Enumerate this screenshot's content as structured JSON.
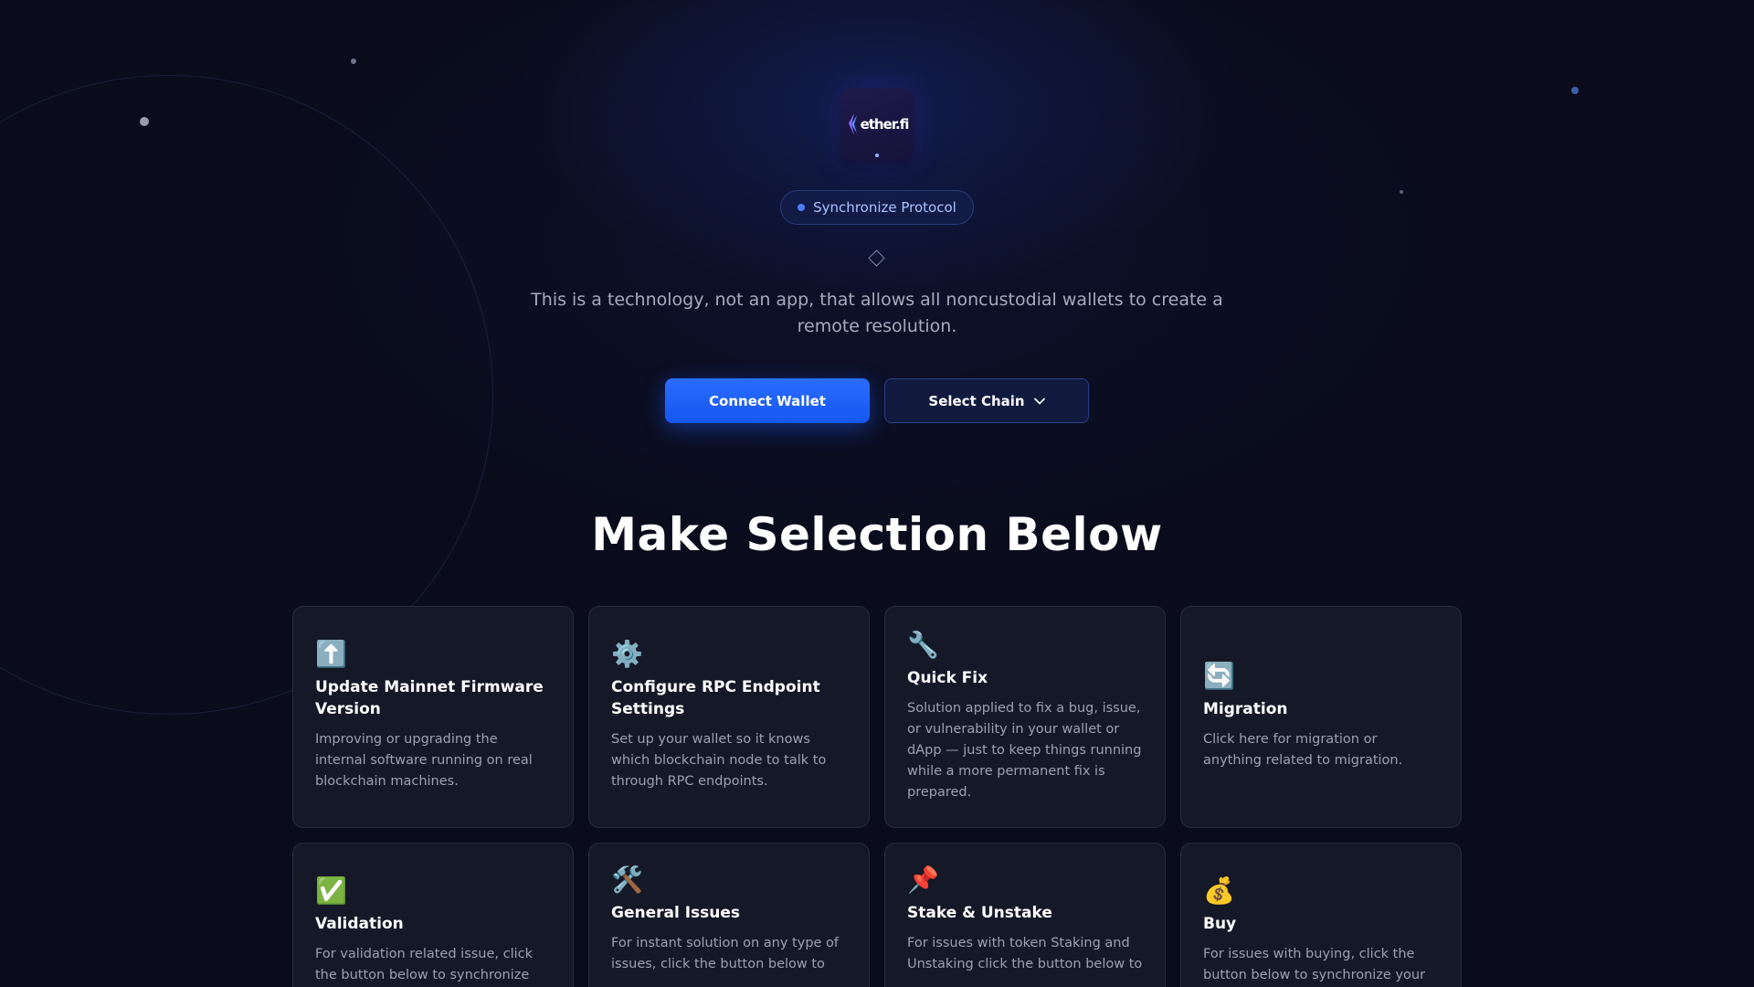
{
  "brand": {
    "logo_text": "ether.fi"
  },
  "badge": {
    "label": "Synchronize Protocol"
  },
  "hero": {
    "subtitle": "This is a technology, not an app, that allows all noncustodial wallets to create a remote resolution."
  },
  "actions": {
    "connect_label": "Connect Wallet",
    "chain_label": "Select Chain"
  },
  "section": {
    "title": "Make Selection Below"
  },
  "cards": [
    {
      "icon": "⬆️",
      "icon_name": "up-arrow-icon",
      "title": "Update Mainnet Firmware Version",
      "desc": "Improving or upgrading the internal software running on real blockchain machines."
    },
    {
      "icon": "⚙️",
      "icon_name": "gear-icon",
      "title": "Configure RPC Endpoint Settings",
      "desc": "Set up your wallet so it knows which blockchain node to talk to through RPC endpoints."
    },
    {
      "icon": "🔧",
      "icon_name": "wrench-icon",
      "title": "Quick Fix",
      "desc": "Solution applied to fix a bug, issue, or vulnerability in your wallet or dApp — just to keep things running while a more permanent fix is prepared."
    },
    {
      "icon": "🔄",
      "icon_name": "refresh-icon",
      "title": "Migration",
      "desc": "Click here for migration or anything related to migration."
    },
    {
      "icon": "✅",
      "icon_name": "check-icon",
      "title": "Validation",
      "desc": "For validation related issue, click the button below to synchronize your"
    },
    {
      "icon": "🛠️",
      "icon_name": "tools-icon",
      "title": "General Issues",
      "desc": "For instant solution on any type of issues, click the button below to"
    },
    {
      "icon": "📌",
      "icon_name": "pin-icon",
      "title": "Stake & Unstake",
      "desc": "For issues with token Staking and Unstaking click the button below to"
    },
    {
      "icon": "💰",
      "icon_name": "money-bag-icon",
      "title": "Buy",
      "desc": "For issues with buying, click the button below to synchronize your"
    }
  ],
  "colors": {
    "background": "#0a0c1b",
    "accent": "#1f63ff",
    "card": "#151827"
  }
}
